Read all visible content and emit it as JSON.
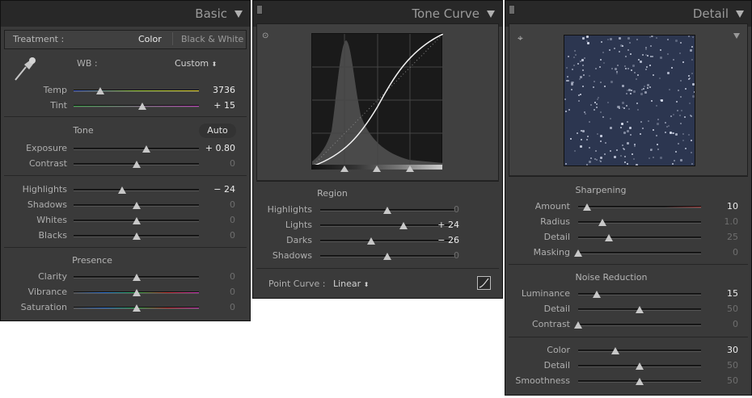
{
  "basic": {
    "title": "Basic",
    "treatment_label": "Treatment :",
    "treatment_color": "Color",
    "treatment_bw": "Black & White",
    "wb_label": "WB :",
    "wb_value": "Custom",
    "temp": {
      "label": "Temp",
      "value": "3736",
      "pos": 0.21
    },
    "tint": {
      "label": "Tint",
      "value": "+ 15",
      "pos": 0.55
    },
    "tone_label": "Tone",
    "auto_label": "Auto",
    "exposure": {
      "label": "Exposure",
      "value": "+ 0.80",
      "pos": 0.58
    },
    "contrast": {
      "label": "Contrast",
      "value": "0",
      "pos": 0.5
    },
    "highlights": {
      "label": "Highlights",
      "value": "− 24",
      "pos": 0.39
    },
    "shadows": {
      "label": "Shadows",
      "value": "0",
      "pos": 0.5
    },
    "whites": {
      "label": "Whites",
      "value": "0",
      "pos": 0.5
    },
    "blacks": {
      "label": "Blacks",
      "value": "0",
      "pos": 0.5
    },
    "presence_label": "Presence",
    "clarity": {
      "label": "Clarity",
      "value": "0",
      "pos": 0.5
    },
    "vibrance": {
      "label": "Vibrance",
      "value": "0",
      "pos": 0.5
    },
    "saturation": {
      "label": "Saturation",
      "value": "0",
      "pos": 0.5
    }
  },
  "tone_curve": {
    "title": "Tone Curve",
    "region_label": "Region",
    "highlights": {
      "label": "Highlights",
      "value": "0",
      "pos": 0.5
    },
    "lights": {
      "label": "Lights",
      "value": "+ 24",
      "pos": 0.62
    },
    "darks": {
      "label": "Darks",
      "value": "− 26",
      "pos": 0.38
    },
    "shadows": {
      "label": "Shadows",
      "value": "0",
      "pos": 0.5
    },
    "point_curve_label": "Point Curve :",
    "point_curve_value": "Linear",
    "split_points": [
      0.25,
      0.5,
      0.75
    ]
  },
  "detail": {
    "title": "Detail",
    "sharpening_label": "Sharpening",
    "amount": {
      "label": "Amount",
      "value": "10",
      "pos": 0.07
    },
    "radius": {
      "label": "Radius",
      "value": "1.0",
      "pos": 0.2
    },
    "detail": {
      "label": "Detail",
      "value": "25",
      "pos": 0.25
    },
    "masking": {
      "label": "Masking",
      "value": "0",
      "pos": 0.0
    },
    "noise_label": "Noise Reduction",
    "luminance": {
      "label": "Luminance",
      "value": "15",
      "pos": 0.15
    },
    "lum_detail": {
      "label": "Detail",
      "value": "50",
      "pos": 0.5
    },
    "lum_contrast": {
      "label": "Contrast",
      "value": "0",
      "pos": 0.0
    },
    "color": {
      "label": "Color",
      "value": "30",
      "pos": 0.3
    },
    "color_detail": {
      "label": "Detail",
      "value": "50",
      "pos": 0.5
    },
    "smoothness": {
      "label": "Smoothness",
      "value": "50",
      "pos": 0.5
    }
  }
}
